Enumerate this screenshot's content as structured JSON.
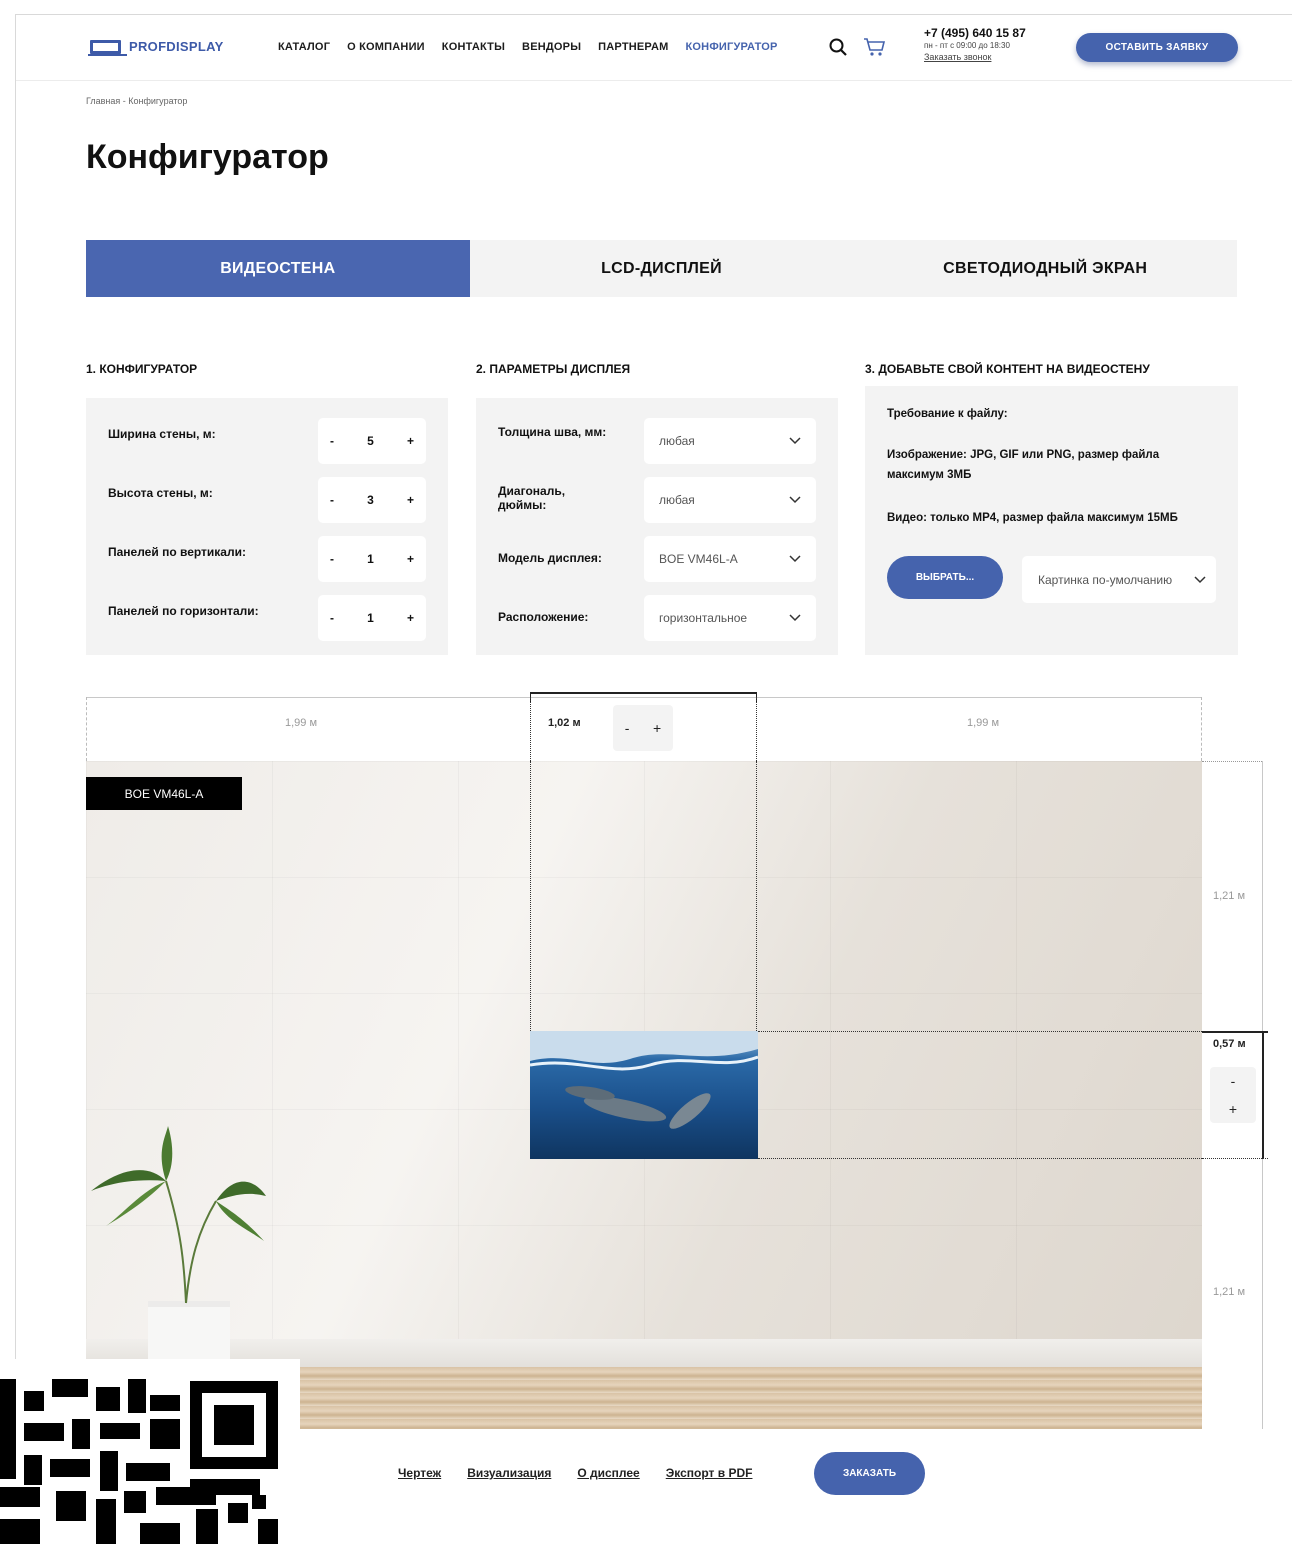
{
  "header": {
    "logo_text": "PROFDISPLAY",
    "nav": [
      "КАТАЛОГ",
      "О КОМПАНИИ",
      "КОНТАКТЫ",
      "ВЕНДОРЫ",
      "ПАРТНЕРАМ",
      "КОНФИГУРАТОР"
    ],
    "phone": "+7 (495) 640 15 87",
    "hours": "пн - пт с 09:00 до 18:30",
    "callback": "Заказать звонок",
    "request_button": "ОСТАВИТЬ ЗАЯВКУ"
  },
  "breadcrumb": "Главная - Конфигуратор",
  "title": "Конфигуратор",
  "tabs": [
    "ВИДЕОСТЕНА",
    "LCD-ДИСПЛЕЙ",
    "СВЕТОДИОДНЫЙ ЭКРАН"
  ],
  "section1": {
    "title": "1. КОНФИГУРАТОР",
    "rows": [
      {
        "label": "Ширина стены, м:",
        "value": "5"
      },
      {
        "label": "Высота стены, м:",
        "value": "3"
      },
      {
        "label": "Панелей по вертикали:",
        "value": "1"
      },
      {
        "label": "Панелей по горизонтали:",
        "value": "1"
      }
    ],
    "minus": "-",
    "plus": "+"
  },
  "section2": {
    "title": "2. ПАРАМЕТРЫ ДИСПЛЕЯ",
    "rows": [
      {
        "label": "Толщина шва, мм:",
        "value": "любая"
      },
      {
        "label": "Диагональ, дюймы:",
        "value": "любая"
      },
      {
        "label": "Модель дисплея:",
        "value": "BOE VM46L-A"
      },
      {
        "label": "Расположение:",
        "value": "горизонтальное"
      }
    ]
  },
  "section3": {
    "title": "3. ДОБАВЬТЕ СВОЙ КОНТЕНТ НА ВИДЕОСТЕНУ",
    "req": "Требование к файлу:",
    "image": "Изображение: JPG, GIF или PNG, размер файла максимум 3МБ",
    "video": "Видео: только MP4, размер файла максимум 15МБ",
    "choose_button": "ВЫБРАТЬ...",
    "picture_select": "Картинка по-умолчанию"
  },
  "measure": {
    "left": "1,99 м",
    "center": "1,02 м",
    "right": "1,99 м",
    "top_v": "1,21 м",
    "mid_v": "0,57 м",
    "bottom_v": "1,21 м"
  },
  "wall": {
    "model_tag": "BOE VM46L-A"
  },
  "bottom": {
    "links": [
      "Чертеж",
      "Визуализация",
      "О дисплее",
      "Экспорт в PDF"
    ],
    "order_button": "ЗАКАЗАТЬ"
  },
  "colors": {
    "accent": "#4563ad",
    "panel_bg": "#f3f3f3"
  }
}
